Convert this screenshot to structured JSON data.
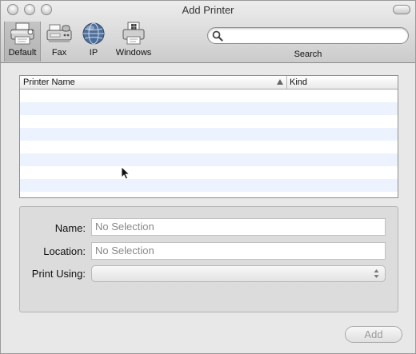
{
  "window": {
    "title": "Add Printer"
  },
  "toolbar": {
    "items": [
      {
        "label": "Default",
        "icon": "printer-icon",
        "selected": true
      },
      {
        "label": "Fax",
        "icon": "fax-icon",
        "selected": false
      },
      {
        "label": "IP",
        "icon": "globe-icon",
        "selected": false
      },
      {
        "label": "Windows",
        "icon": "windows-printer-icon",
        "selected": false
      }
    ],
    "search": {
      "label": "Search",
      "value": "",
      "placeholder": ""
    }
  },
  "printer_list": {
    "columns": [
      {
        "label": "Printer Name",
        "sort": "ascending"
      },
      {
        "label": "Kind"
      }
    ],
    "rows": []
  },
  "details": {
    "name_label": "Name:",
    "name_value": "No Selection",
    "location_label": "Location:",
    "location_value": "No Selection",
    "print_using_label": "Print Using:",
    "print_using_value": ""
  },
  "actions": {
    "add_label": "Add",
    "add_enabled": false
  },
  "colors": {
    "row_alt": "#edf3fe",
    "disabled_text": "#9a9a9a"
  }
}
